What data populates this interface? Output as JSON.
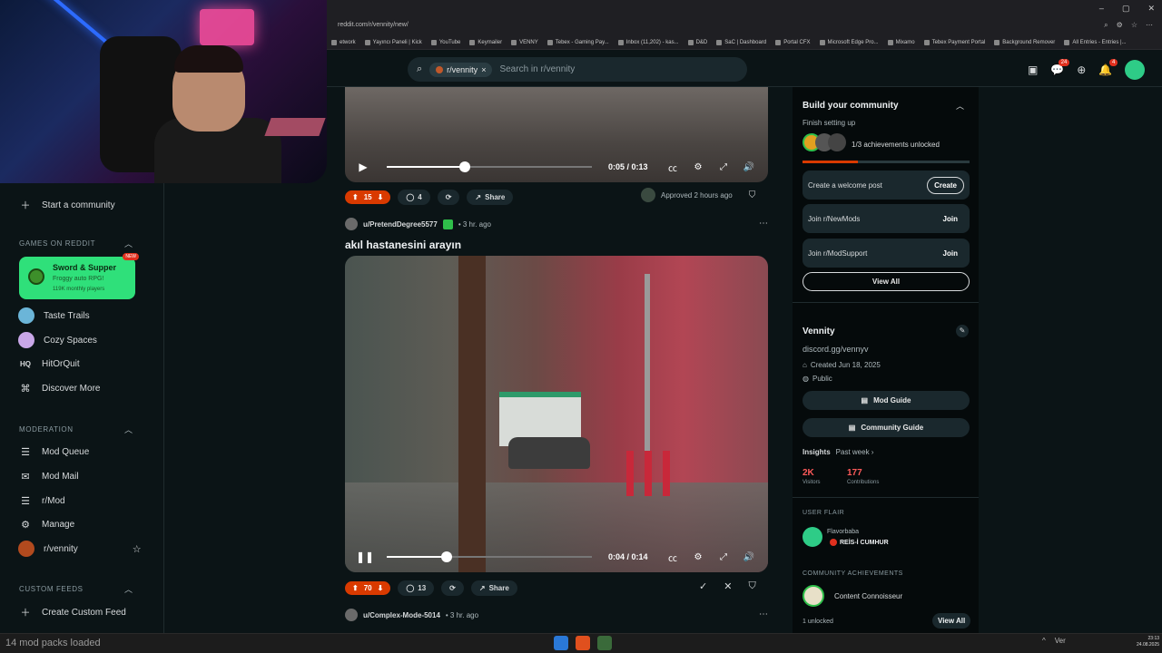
{
  "browser": {
    "url": "reddit.com/r/vennity/new/",
    "bookmarks": [
      "etwork",
      "Yayıncı Paneli | Kick",
      "YouTube",
      "Keymailer",
      "VENNY",
      "Tebex - Gaming Pay...",
      "Inbox (11,202) - kas...",
      "D&D",
      "SaC | Dashboard",
      "Portal CFX",
      "Microsoft Edge Pro...",
      "Mixamo",
      "Tebex Payment Portal",
      "Background Remover",
      "All Entries - Entries |..."
    ],
    "ctrl_min": "–",
    "ctrl_max": "▢",
    "ctrl_close": "✕"
  },
  "header": {
    "search_chip": "r/vennity",
    "search_chip_close": "×",
    "search_placeholder": "Search in r/vennity",
    "chat_badge": "24",
    "notif_badge": "4"
  },
  "sidebar": {
    "start_community": "Start a community",
    "games_title": "GAMES ON REDDIT",
    "game_card": {
      "title": "Sword & Supper",
      "subtitle": "Froggy auto RPG!",
      "players": "119K monthly players",
      "badge": "NEW"
    },
    "games": [
      "Taste Trails",
      "Cozy Spaces",
      "HitOrQuit",
      "Discover More"
    ],
    "moderation_title": "MODERATION",
    "moderation": [
      "Mod Queue",
      "Mod Mail",
      "r/Mod",
      "Manage",
      "r/vennity"
    ],
    "custom_title": "CUSTOM FEEDS",
    "create_custom": "Create Custom Feed"
  },
  "feed": {
    "post1": {
      "time": "0:05 / 0:13",
      "progress": 0.38,
      "votes": "15",
      "comments": "4",
      "share": "Share",
      "approved": "Approved 2 hours ago"
    },
    "post2": {
      "user": "u/PretendDegree5577",
      "age": "• 3 hr. ago",
      "title": "akıl hastanesini arayın",
      "time": "0:04 / 0:14",
      "progress": 0.29,
      "votes": "70",
      "comments": "13",
      "share": "Share"
    },
    "post3": {
      "user": "u/Complex-Mode-5014",
      "age": "• 3 hr. ago"
    }
  },
  "right": {
    "build_title": "Build your community",
    "finish": "Finish setting up",
    "achievements": "1/3 achievements unlocked",
    "achievement_progress": 0.33,
    "welcome": "Create a welcome post",
    "create_btn": "Create",
    "join1": "Join r/NewMods",
    "join2": "Join r/ModSupport",
    "join_btn": "Join",
    "view_all": "View All",
    "community_name": "Vennity",
    "community_desc": "discord.gg/vennyv",
    "created": "Created Jun 18, 2025",
    "visibility": "Public",
    "mod_guide": "Mod Guide",
    "community_guide": "Community Guide",
    "insights": "Insights",
    "past_week": "Past week ›",
    "visitors_val": "2K",
    "visitors_label": "Visitors",
    "contrib_val": "177",
    "contrib_label": "Contributions",
    "user_flair_title": "USER FLAIR",
    "flair_user": "Flavorbaba",
    "flair_text": "REİS-İ CUMHUR",
    "ach_title": "COMMUNITY ACHIEVEMENTS",
    "ach_name": "Content Connoisseur",
    "unlocked": "1 unlocked",
    "ach_view_all": "View All"
  },
  "taskbar": {
    "status": "14 mod packs loaded",
    "tray_text": "Ver",
    "clock_time": "23:13",
    "clock_date": "24.08.2025"
  },
  "colors": {
    "accent": "#d93a00",
    "bg": "#0b1416",
    "green": "#2fe07a"
  }
}
